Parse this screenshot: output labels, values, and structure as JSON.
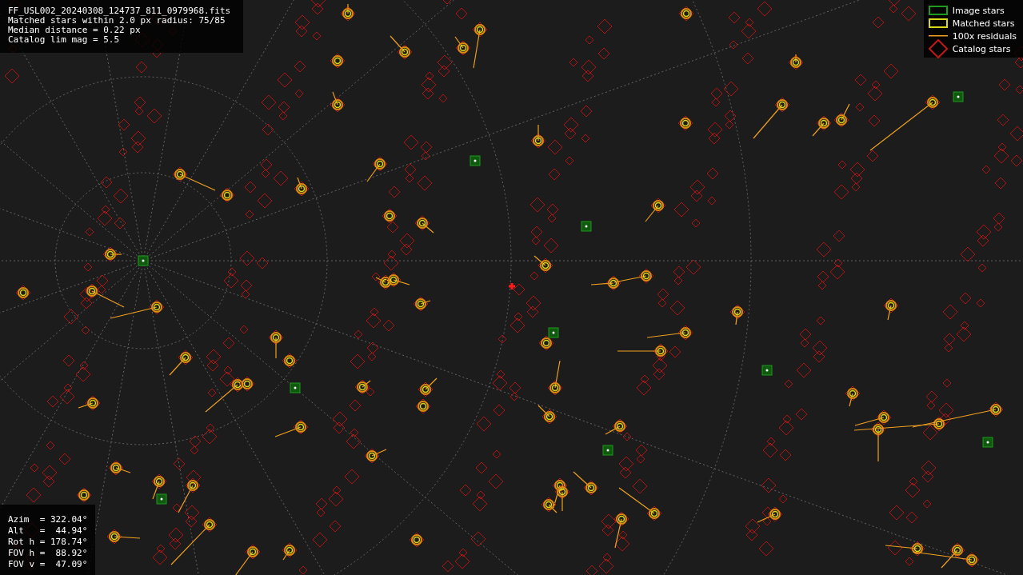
{
  "info_panel": {
    "lines": [
      "FF_USL002_20240308_124737_811_0979968.fits",
      "Matched stars within 2.0 px radius: 75/85",
      "Median distance = 0.22 px",
      "Catalog lim mag = 5.5"
    ]
  },
  "legend": [
    {
      "kind": "image",
      "label": "Image stars"
    },
    {
      "kind": "matched",
      "label": "Matched stars"
    },
    {
      "kind": "residual",
      "label": "100x residuals"
    },
    {
      "kind": "catalog",
      "label": "Catalog stars"
    }
  ],
  "pointing_panel": {
    "lines": [
      "Azim  = 322.04°",
      "Alt   =  44.94°",
      "Rot h = 178.74°",
      "FOV h =  88.92°",
      "FOV v =  47.09°"
    ]
  }
}
